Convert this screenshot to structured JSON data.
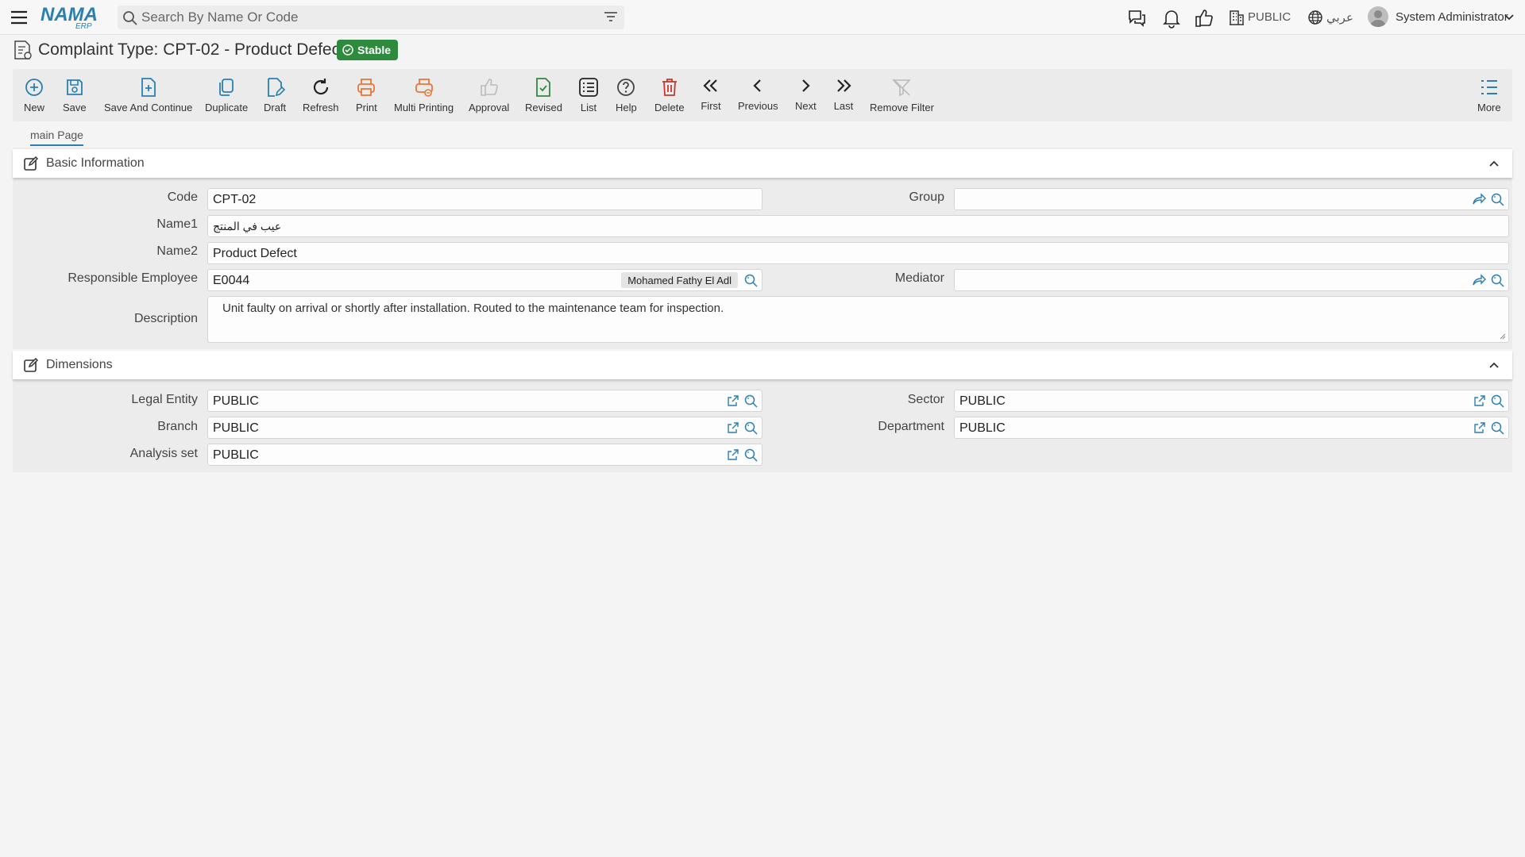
{
  "header": {
    "logo_text": "NAMA",
    "logo_sub": "ERP",
    "search_placeholder": "Search By Name Or Code",
    "company": "PUBLIC",
    "language": "عربي",
    "user": "System Administrator"
  },
  "title": {
    "text": "Complaint Type: CPT-02 - Product Defect",
    "status": "Stable",
    "status_color": "#2e8b3e"
  },
  "toolbar": {
    "new": "New",
    "save": "Save",
    "save_continue": "Save And Continue",
    "duplicate": "Duplicate",
    "draft": "Draft",
    "refresh": "Refresh",
    "print": "Print",
    "multi_printing": "Multi Printing",
    "approval": "Approval",
    "revised": "Revised",
    "list": "List",
    "help": "Help",
    "delete": "Delete",
    "first": "First",
    "previous": "Previous",
    "next": "Next",
    "last": "Last",
    "remove_filter": "Remove Filter",
    "more": "More"
  },
  "tabs": {
    "main": "main Page"
  },
  "basic": {
    "title": "Basic Information",
    "code_label": "Code",
    "code_value": "CPT-02",
    "group_label": "Group",
    "group_value": "",
    "name1_label": "Name1",
    "name1_value": "عيب في المنتج",
    "name2_label": "Name2",
    "name2_value": "Product Defect",
    "resp_label": "Responsible Employee",
    "resp_code": "E0044",
    "resp_name": "Mohamed Fathy El Adl",
    "mediator_label": "Mediator",
    "mediator_value": "",
    "desc_label": "Description",
    "desc_value": "Unit faulty on arrival or shortly after installation. Routed to the maintenance team for inspection."
  },
  "dimensions": {
    "title": "Dimensions",
    "legal_label": "Legal Entity",
    "legal_value": "PUBLIC",
    "sector_label": "Sector",
    "sector_value": "PUBLIC",
    "branch_label": "Branch",
    "branch_value": "PUBLIC",
    "department_label": "Department",
    "department_value": "PUBLIC",
    "analysis_label": "Analysis set",
    "analysis_value": "PUBLIC"
  },
  "colors": {
    "accent": "#2a7fb3",
    "print": "#e8763a",
    "delete": "#c23a2e",
    "revised": "#2e8b3e"
  }
}
